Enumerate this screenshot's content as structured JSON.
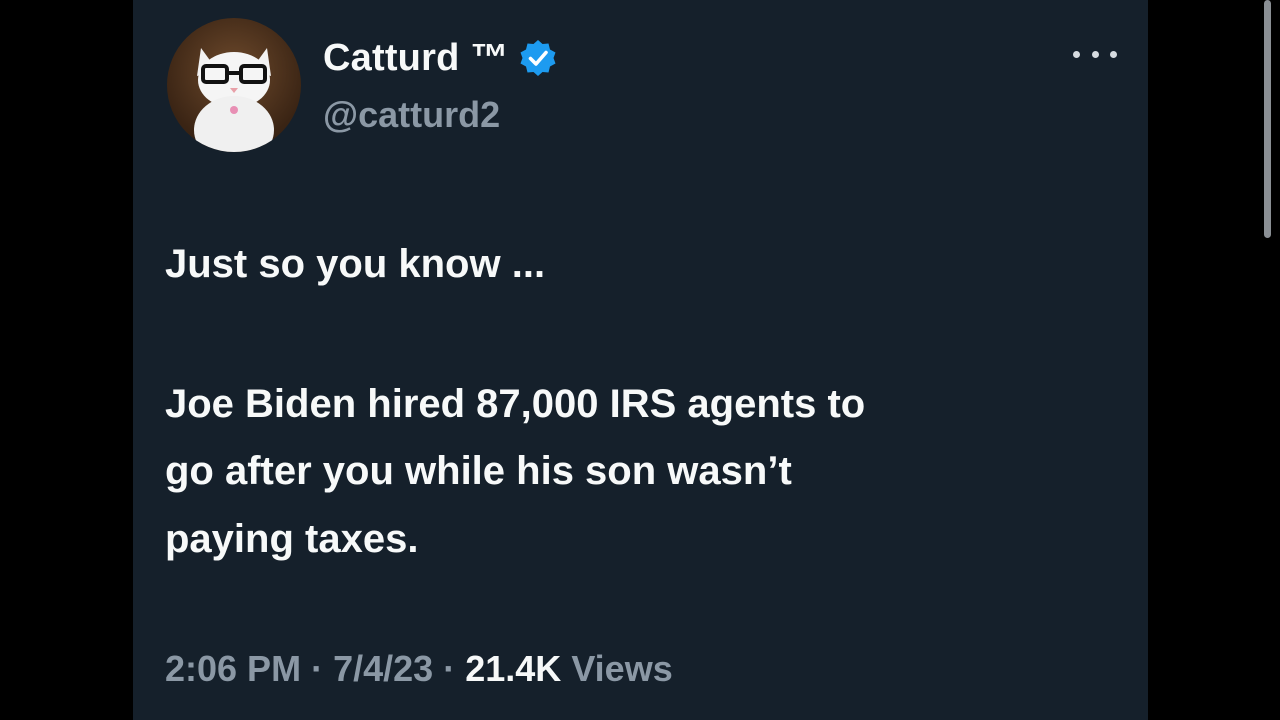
{
  "tweet": {
    "author": {
      "display_name": "Catturd ™",
      "handle": "@catturd2",
      "avatar_icon": "cat-with-glasses-avatar",
      "verified_icon": "verified-badge-icon",
      "verified_color": "#1d9bf0"
    },
    "menu_icon": "more-options-icon",
    "text_lines": [
      "Just so you know ...",
      "Joe Biden hired 87,000 IRS agents to",
      "go after you while his son wasn’t",
      "paying taxes."
    ],
    "time": "2:06 PM",
    "separator": "·",
    "date": "7/4/23",
    "views_count": "21.4K",
    "views_label": "Views"
  },
  "colors": {
    "background": "#15202b",
    "primary_text": "#f7f9f9",
    "secondary_text": "#8b98a5",
    "accent": "#1d9bf0"
  }
}
